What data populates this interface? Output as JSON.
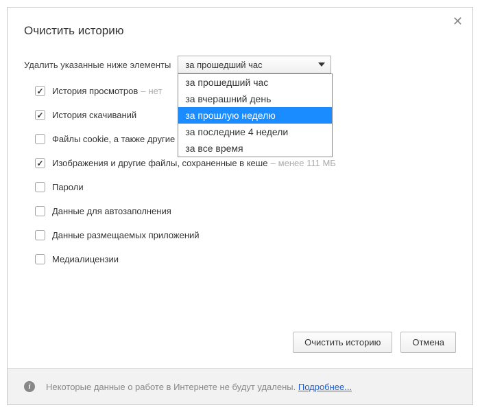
{
  "dialog": {
    "title": "Очистить историю",
    "range_label": "Удалить указанные ниже элементы",
    "selected_range": "за прошедший час",
    "dropdown": [
      {
        "label": "за прошедший час",
        "selected": false
      },
      {
        "label": "за вчерашний день",
        "selected": false
      },
      {
        "label": "за прошлую неделю",
        "selected": true
      },
      {
        "label": "за последние 4 недели",
        "selected": false
      },
      {
        "label": "за все время",
        "selected": false
      }
    ],
    "items": [
      {
        "checked": true,
        "label": "История просмотров",
        "suffix": "нет"
      },
      {
        "checked": true,
        "label": "История скачиваний",
        "suffix": ""
      },
      {
        "checked": false,
        "label": "Файлы cookie, а также другие д",
        "suffix": ""
      },
      {
        "checked": true,
        "label": "Изображения и другие файлы, сохраненные в кеше",
        "suffix": "менее 111 МБ"
      },
      {
        "checked": false,
        "label": "Пароли",
        "suffix": ""
      },
      {
        "checked": false,
        "label": "Данные для автозаполнения",
        "suffix": ""
      },
      {
        "checked": false,
        "label": "Данные размещаемых приложений",
        "suffix": ""
      },
      {
        "checked": false,
        "label": "Медиалицензии",
        "suffix": ""
      }
    ],
    "buttons": {
      "clear": "Очистить историю",
      "cancel": "Отмена"
    },
    "footer": {
      "text": "Некоторые данные о работе в Интернете не будут удалены. ",
      "link": "Подробнее..."
    }
  }
}
